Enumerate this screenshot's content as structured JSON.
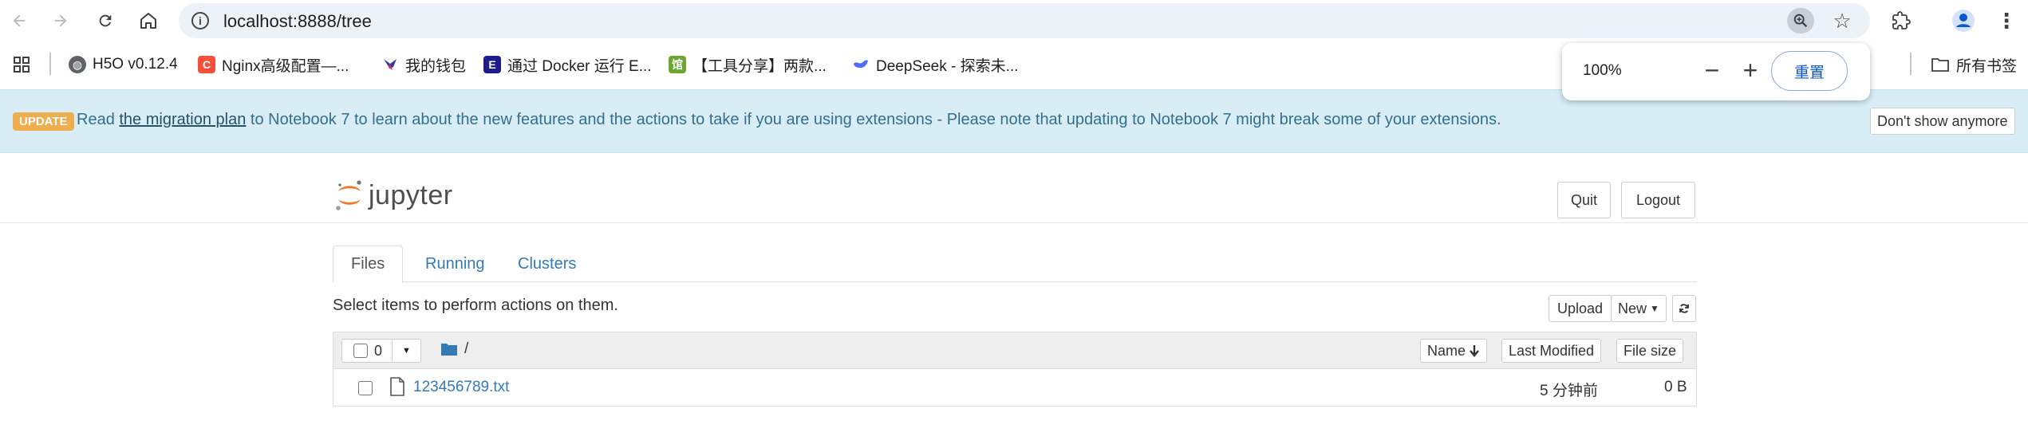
{
  "browser": {
    "url": "localhost:8888/tree",
    "bookmarks": [
      {
        "label": "H5O v0.12.4",
        "icon": "globe-icon"
      },
      {
        "label": "Nginx高级配置—...",
        "icon": "c-logo-icon"
      },
      {
        "label": "我的钱包",
        "icon": "bird-icon"
      },
      {
        "label": "通过 Docker 运行 E...",
        "icon": "e-logo-icon"
      },
      {
        "label": "【工具分享】两款...",
        "icon": "app-icon"
      },
      {
        "label": "DeepSeek - 探索未...",
        "icon": "deepseek-icon"
      }
    ],
    "all_bookmarks": "所有书签",
    "zoom_popup": {
      "percent": "100%",
      "minus": "−",
      "plus": "+",
      "reset": "重置"
    }
  },
  "update": {
    "badge": "UPDATE",
    "text_before": "Read ",
    "link": "the migration plan",
    "text_after": " to Notebook 7 to learn about the new features and the actions to take if you are using extensions - Please note that updating to Notebook 7 might break some of your extensions.",
    "dismiss": "Don't show anymore"
  },
  "header": {
    "logo_text": "jupyter",
    "quit": "Quit",
    "logout": "Logout"
  },
  "tabs": [
    {
      "label": "Files",
      "active": true
    },
    {
      "label": "Running",
      "active": false
    },
    {
      "label": "Clusters",
      "active": false
    }
  ],
  "toolbar": {
    "message": "Select items to perform actions on them.",
    "upload": "Upload",
    "new": "New"
  },
  "list": {
    "selected_count": "0",
    "breadcrumb": "/",
    "columns": {
      "name": "Name",
      "last_modified": "Last Modified",
      "file_size": "File size"
    },
    "rows": [
      {
        "name": "123456789.txt",
        "modified": "5 分钟前",
        "size": "0 B"
      }
    ]
  },
  "colors": {
    "accent": "#337ab7",
    "update_bg": "#d9edf7",
    "badge": "#f0ad4e",
    "jupyter_orange": "#f37726"
  }
}
